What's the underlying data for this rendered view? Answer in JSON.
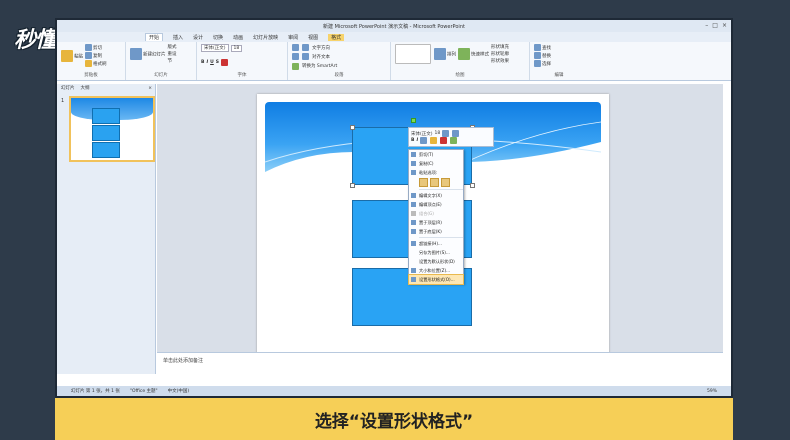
{
  "logo": {
    "text": "秒懂视频"
  },
  "window": {
    "title": "新建 Microsoft PowerPoint 演示文稿 - Microsoft PowerPoint",
    "controls": [
      "–",
      "□",
      "×"
    ]
  },
  "ribbon_tabs": [
    "开始",
    "插入",
    "设计",
    "切换",
    "动画",
    "幻灯片放映",
    "审阅",
    "视图",
    "格式"
  ],
  "context_tab": "绘图工具",
  "ribbon": {
    "clipboard": {
      "paste": "粘贴",
      "cut": "剪切",
      "copy": "复制",
      "format_painter": "格式刷",
      "label": "剪贴板"
    },
    "slides": {
      "new_slide": "新建幻灯片",
      "layout": "版式",
      "reset": "重设",
      "section": "节",
      "label": "幻灯片"
    },
    "font": {
      "name": "宋体(正文)",
      "size": "18",
      "label": "字体"
    },
    "paragraph": {
      "text_direction": "文字方向",
      "align_text": "对齐文本",
      "smartart": "转换为 SmartArt",
      "label": "段落"
    },
    "drawing": {
      "arrange": "排列",
      "quick_styles": "快速样式",
      "shape_fill": "形状填充",
      "shape_outline": "形状轮廓",
      "shape_effects": "形状效果",
      "label": "绘图"
    },
    "editing": {
      "find": "查找",
      "replace": "替换",
      "select": "选择",
      "label": "编辑"
    }
  },
  "left_pane": {
    "tabs": [
      "幻灯片",
      "大纲"
    ],
    "close": "×",
    "slide_number": "1"
  },
  "mini_toolbar": {
    "font": "宋体(正文)",
    "size": "18"
  },
  "context_menu": {
    "items": [
      {
        "label": "剪切(T)",
        "disabled": false
      },
      {
        "label": "复制(C)",
        "disabled": false
      },
      {
        "label": "粘贴选项:",
        "disabled": false
      },
      {
        "label": "编辑文字(X)",
        "disabled": false
      },
      {
        "label": "编辑顶点(E)",
        "disabled": false
      },
      {
        "label": "组合(G)",
        "disabled": true
      },
      {
        "label": "置于顶层(R)",
        "disabled": false
      },
      {
        "label": "置于底层(K)",
        "disabled": false
      },
      {
        "label": "超链接(H)...",
        "disabled": false
      },
      {
        "label": "另存为图片(S)...",
        "disabled": false
      },
      {
        "label": "设置为默认形状(D)",
        "disabled": false
      },
      {
        "label": "大小和位置(Z)...",
        "disabled": false
      },
      {
        "label": "设置形状格式(O)...",
        "disabled": false,
        "highlighted": true
      }
    ]
  },
  "notes": {
    "placeholder": "单击此处添加备注"
  },
  "statusbar": {
    "slide_info": "幻灯片 第 1 张，共 1 张",
    "theme": "\"Office 主题\"",
    "language": "中文(中国)",
    "zoom": "59%"
  },
  "caption": {
    "text": "选择“设置形状格式”"
  }
}
